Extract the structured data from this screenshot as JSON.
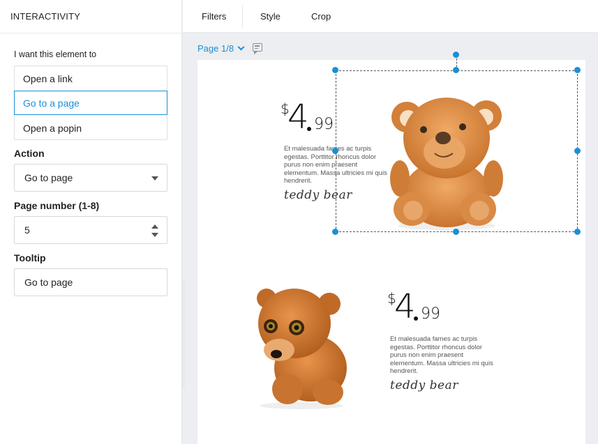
{
  "panel": {
    "title": "INTERACTIVITY",
    "intent_label": "I want this element to",
    "options": [
      "Open a link",
      "Go to a page",
      "Open a popin"
    ],
    "selected_option": "Go to a page",
    "action_label": "Action",
    "action_value": "Go to page",
    "page_number_label": "Page number (1-8)",
    "page_number_value": "5",
    "tooltip_label": "Tooltip",
    "tooltip_value": "Go to page"
  },
  "toolbar": {
    "filters": "Filters",
    "style": "Style",
    "crop": "Crop"
  },
  "page_indicator": "Page 1/8",
  "products": [
    {
      "currency": "$",
      "price_whole": "4",
      "price_cents": "99",
      "description": "Et malesuada fames ac turpis egestas. Porttitor rhoncus dolor purus non enim praesent elementum. Massa ultricies mi quis hendrerit.",
      "name": "teddy bear"
    },
    {
      "currency": "$",
      "price_whole": "4",
      "price_cents": "99",
      "description": "Et malesuada fames ac turpis egestas. Porttitor rhoncus dolor purus non enim praesent elementum. Massa ultricies mi quis hendrerit.",
      "name": "teddy bear"
    }
  ],
  "colors": {
    "accent": "#1a8fd6",
    "bear_light": "#e59a53",
    "bear_dark": "#b9621f"
  }
}
